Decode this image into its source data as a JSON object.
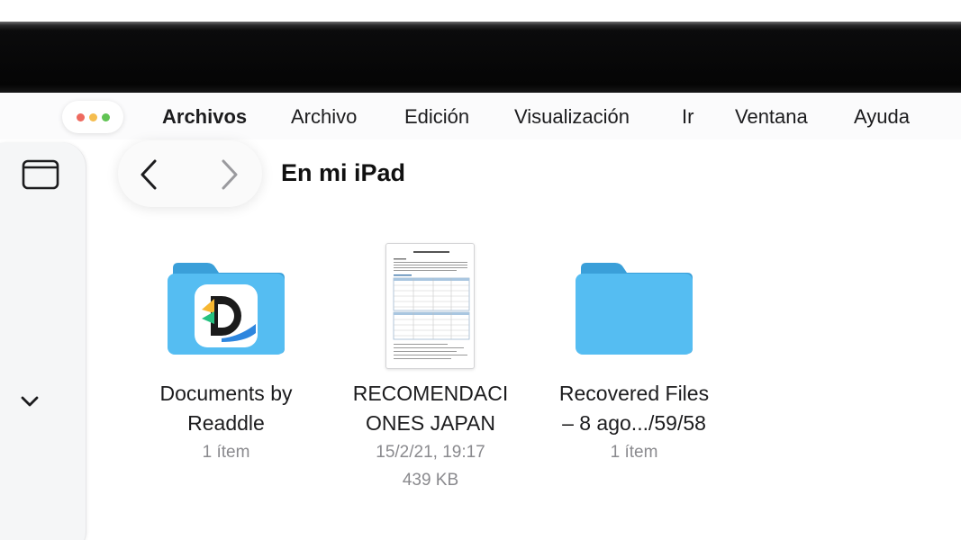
{
  "menubar": {
    "app_name": "Archivos",
    "items": [
      "Archivo",
      "Edición",
      "Visualización",
      "Ir",
      "Ventana",
      "Ayuda"
    ],
    "traffic_colors": [
      "#ee6a5f",
      "#f5bd4f",
      "#61c454"
    ]
  },
  "toolbar": {
    "title": "En mi iPad",
    "back_icon": "chevron-left-icon",
    "forward_icon": "chevron-right-icon",
    "sidebar_icon": "sidebar-toggle-icon"
  },
  "files": [
    {
      "name_line1": "Documents by",
      "name_line2": "Readdle",
      "meta1": "1 ítem",
      "meta2": "",
      "icon": "documents-folder-icon"
    },
    {
      "name_line1": "RECOMENDACI",
      "name_line2": "ONES JAPAN",
      "meta1": "15/2/21, 19:17",
      "meta2": "439 KB",
      "icon": "pdf-document-thumbnail"
    },
    {
      "name_line1": "Recovered Files",
      "name_line2": "– 8 ago.../59/58",
      "meta1": "1 ítem",
      "meta2": "",
      "icon": "folder-icon"
    }
  ],
  "colors": {
    "folder_blue": "#4fb6ee",
    "folder_tab": "#3a9fd9",
    "accent": "#1c1c1e"
  }
}
